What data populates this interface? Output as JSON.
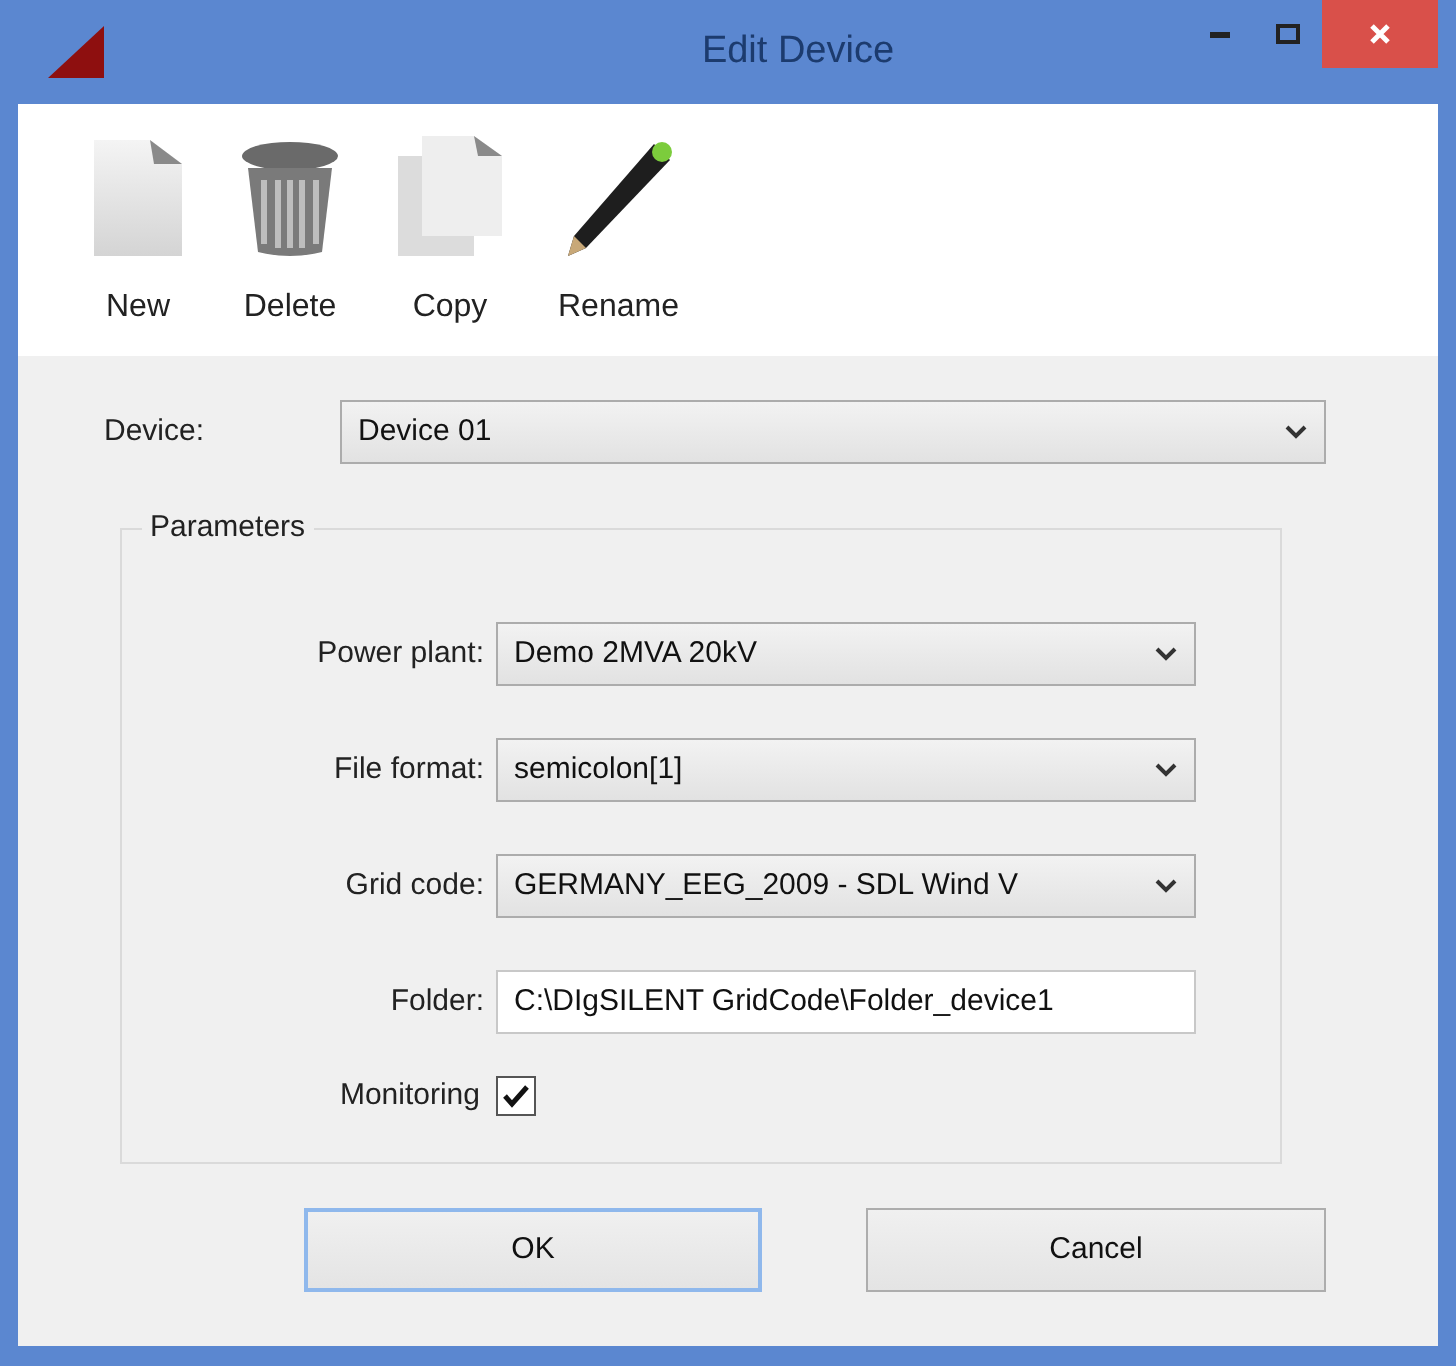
{
  "window": {
    "title": "Edit Device"
  },
  "toolbar": [
    {
      "label": "New",
      "kind": "new"
    },
    {
      "label": "Delete",
      "kind": "delete"
    },
    {
      "label": "Copy",
      "kind": "copy"
    },
    {
      "label": "Rename",
      "kind": "rename"
    }
  ],
  "device": {
    "label": "Device:",
    "value": "Device 01"
  },
  "parameters": {
    "title": "Parameters",
    "fields": [
      {
        "label": "Power plant:",
        "value": "Demo 2MVA 20kV",
        "kind": "dropdown"
      },
      {
        "label": "File format:",
        "value": "semicolon[1]",
        "kind": "dropdown"
      },
      {
        "label": "Grid code:",
        "value": "GERMANY_EEG_2009 - SDL Wind V",
        "kind": "dropdown"
      },
      {
        "label": "Folder:",
        "value": "C:\\DIgSILENT GridCode\\Folder_device1",
        "kind": "text"
      }
    ],
    "monitoring": {
      "label": "Monitoring",
      "checked": true
    }
  },
  "buttons": [
    {
      "label": "OK",
      "focused": true
    },
    {
      "label": "Cancel",
      "focused": false
    }
  ]
}
